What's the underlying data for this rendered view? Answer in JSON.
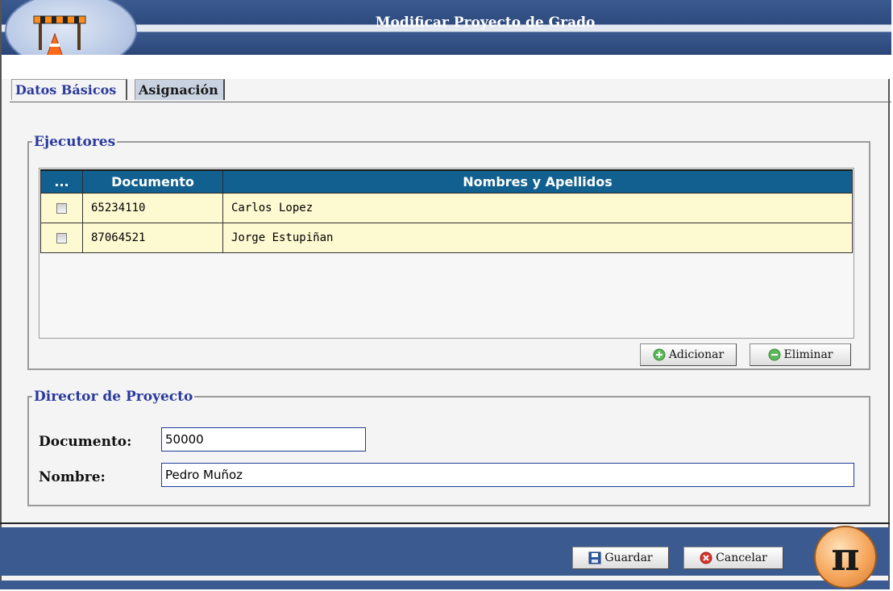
{
  "window": {
    "title": "Modificar Proyecto de Grado"
  },
  "tabs": [
    {
      "label": "Datos Básicos",
      "active": true
    },
    {
      "label": "Asignación",
      "active": false
    }
  ],
  "ejecutores": {
    "legend": "Ejecutores",
    "columns": [
      "...",
      "Documento",
      "Nombres y Apellidos"
    ],
    "rows": [
      {
        "checked": false,
        "documento": "65234110",
        "nombre": "Carlos Lopez"
      },
      {
        "checked": false,
        "documento": "87064521",
        "nombre": "Jorge Estupiñan"
      }
    ],
    "add_label": "Adicionar",
    "remove_label": "Eliminar"
  },
  "director": {
    "legend": "Director de Proyecto",
    "documento_label": "Documento:",
    "documento_value": "50000",
    "nombre_label": "Nombre:",
    "nombre_value": "Pedro Muñoz"
  },
  "footer": {
    "save_label": "Guardar",
    "cancel_label": "Cancelar",
    "logo_symbol": "π"
  },
  "colors": {
    "header_blue": "#3b5a8f",
    "grid_header": "#12608f",
    "row_bg": "#fdf9d0",
    "legend_text": "#2a3a9e"
  },
  "icons": {
    "header_logo": "barrier-cone-icon",
    "add": "plus-circle-icon",
    "remove": "minus-circle-icon",
    "save": "floppy-disk-icon",
    "cancel": "x-circle-icon",
    "brand": "pi-logo-icon"
  }
}
